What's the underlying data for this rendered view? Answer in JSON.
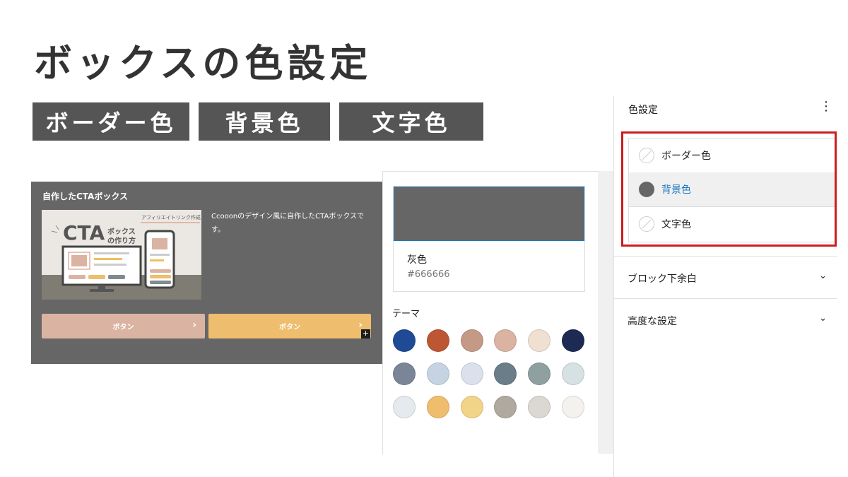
{
  "title": "ボックスの色設定",
  "labels": [
    "ボーダー色",
    "背景色",
    "文字色"
  ],
  "cta": {
    "title": "自作したCTAボックス",
    "description": "Ccooonのデザイン風に自作したCTAボックスです。",
    "image": {
      "big_text": "CTA",
      "small_text1": "ボックス",
      "small_text2": "の作り方",
      "tag": "アフィリエイトリンク作成"
    },
    "buttons": [
      {
        "label": "ボタン",
        "color": "#dbb3a3"
      },
      {
        "label": "ボタン",
        "color": "#eebd6d"
      }
    ],
    "background": "#666666",
    "plus": "+"
  },
  "color_panel": {
    "selected_name": "灰色",
    "selected_hex": "#666666",
    "theme_label": "テーマ",
    "palette": [
      [
        "#1f4b96",
        "#bd5633",
        "#c49986",
        "#dbb3a3",
        "#efe0d2",
        "#1c2a54"
      ],
      [
        "#7a8598",
        "#c6d3e3",
        "#dae1ec",
        "#6a7d88",
        "#8ea0a0",
        "#d6e1e3"
      ],
      [
        "#e4eaee",
        "#eebd6d",
        "#f2d488",
        "#b0a99f",
        "#dbd7d1",
        "#f4f2ee"
      ]
    ]
  },
  "sidebar": {
    "header": "色設定",
    "menu_icon": "⋮",
    "options": [
      {
        "label": "ボーダー色",
        "state": "none"
      },
      {
        "label": "背景色",
        "state": "set",
        "color": "#666666"
      },
      {
        "label": "文字色",
        "state": "none"
      }
    ],
    "sections": [
      {
        "label": "ブロック下余白"
      },
      {
        "label": "高度な設定"
      }
    ],
    "accent": "#1a7ac1",
    "highlight": "#cc1d1d"
  }
}
